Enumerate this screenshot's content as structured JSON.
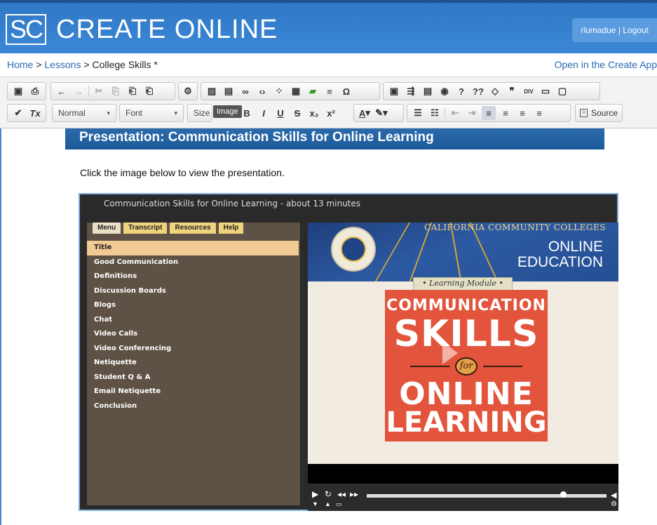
{
  "app": {
    "logo_initials": "SC",
    "title": "CREATE ONLINE",
    "user": "rlumadue",
    "separator": "|",
    "logout": "Logout"
  },
  "breadcrumb": {
    "home": "Home",
    "sep": ">",
    "lessons": "Lessons",
    "current": "College Skills *",
    "open_link": "Open in the Create App"
  },
  "toolbar": {
    "style_combo": "Normal",
    "font_combo": "Font",
    "size_combo": "Size",
    "tooltip": "Image",
    "source_label": "Source"
  },
  "content": {
    "banner": "Presentation: Communication Skills for Online Learning",
    "instruction": "Click the image below to view the presentation."
  },
  "player": {
    "title": "Communication Skills for Online Learning - about 13 minutes",
    "tabs": [
      "Menu",
      "Transcript",
      "Resources",
      "Help"
    ],
    "menu_items": [
      "Title",
      "Good Communication",
      "Definitions",
      "Discussion Boards",
      "Blogs",
      "Chat",
      "Video Calls",
      "Video Conferencing",
      "Netiquette",
      "Student Q & A",
      "Email Netiquette",
      "Conclusion"
    ],
    "selected_index": 0,
    "progress": 0.82
  },
  "slide": {
    "ccc": "CALIFORNIA COMMUNITY COLLEGES",
    "online": "ONLINE",
    "education": "EDUCATION",
    "module": "• Learning Module •",
    "line1": "COMMUNICATION",
    "line2": "SKILLS",
    "for": "for",
    "line3": "ONLINE",
    "line4": "LEARNING"
  },
  "colors": {
    "brand_blue": "#3b87d6",
    "banner_blue": "#1d5a98",
    "tab_gold": "#f0d37e",
    "panel_brown": "#5e5145",
    "card_orange": "#e2553c"
  }
}
